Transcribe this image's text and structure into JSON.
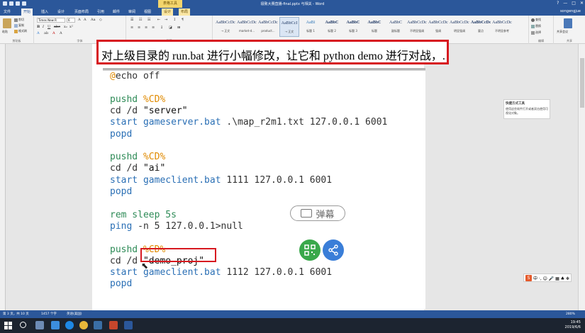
{
  "window": {
    "title": "极致大赛直播-final.pptx 与相关 - Word",
    "context_tab_title": "表格工具",
    "controls": [
      "?",
      "—",
      "□",
      "✕"
    ],
    "user": "songengjue"
  },
  "tabs": [
    "文件",
    "开始",
    "插入",
    "设计",
    "页面布局",
    "引用",
    "邮件",
    "审阅",
    "视图",
    "设计",
    "布局"
  ],
  "ribbon": {
    "clipboard": {
      "paste": "粘贴",
      "cut": "剪切",
      "copy": "复制",
      "painter": "格式刷",
      "label": "剪贴板"
    },
    "font": {
      "name": "Times New R",
      "size": "6",
      "label": "字体"
    },
    "paragraph": {
      "label": "段落"
    },
    "styles": {
      "label": "样式",
      "items": [
        {
          "sample": "AaBbCcDc",
          "name": "→ 正文"
        },
        {
          "sample": "AaBbCcDc",
          "name": "market-d..."
        },
        {
          "sample": "AaBbCcDc",
          "name": "product..."
        },
        {
          "sample": "AaBbCcI",
          "name": "→ 正文"
        },
        {
          "sample": "AaBl",
          "name": "标题 1"
        },
        {
          "sample": "AaBbC",
          "name": "标题 2"
        },
        {
          "sample": "AaBbC",
          "name": "标题 3"
        },
        {
          "sample": "AaBbC",
          "name": "标题"
        },
        {
          "sample": "AaBbC",
          "name": "副标题"
        },
        {
          "sample": "AaBbCcDc",
          "name": "不明显强调"
        },
        {
          "sample": "AaBbCcDc",
          "name": "强调"
        },
        {
          "sample": "AaBbCcDc",
          "name": "明显强调"
        },
        {
          "sample": "AaBbCcDc",
          "name": "要点"
        },
        {
          "sample": "AaBbCcDc",
          "name": "不明显参考"
        }
      ]
    },
    "editing": {
      "find": "查找",
      "replace": "替换",
      "select": "选择",
      "label": "编辑"
    },
    "share": {
      "label": "共享",
      "meeting": "共享会议"
    }
  },
  "instruction": "对上级目录的 run.bat 进行小幅修改，让它和 python demo 进行对战，.",
  "code": [
    [
      {
        "t": "@",
        "c": "var"
      },
      {
        "t": "echo off",
        "c": "op"
      }
    ],
    [],
    [
      {
        "t": "pushd ",
        "c": "kw"
      },
      {
        "t": "%CD%",
        "c": "var"
      }
    ],
    [
      {
        "t": "cd /d ",
        "c": "op"
      },
      {
        "t": "\"server\"",
        "c": "str"
      }
    ],
    [
      {
        "t": "start ",
        "c": "bl"
      },
      {
        "t": "gameserver.bat ",
        "c": "bl"
      },
      {
        "t": ".\\map_r2m1.txt 127.0.0.1 6001",
        "c": "op"
      }
    ],
    [
      {
        "t": "popd",
        "c": "bl"
      }
    ],
    [],
    [
      {
        "t": "pushd ",
        "c": "kw"
      },
      {
        "t": "%CD%",
        "c": "var"
      }
    ],
    [
      {
        "t": "cd /d ",
        "c": "op"
      },
      {
        "t": "\"ai\"",
        "c": "str"
      }
    ],
    [
      {
        "t": "start ",
        "c": "bl"
      },
      {
        "t": "gameclient.bat ",
        "c": "bl"
      },
      {
        "t": "1111 127.0.0.1 6001",
        "c": "op"
      }
    ],
    [
      {
        "t": "popd",
        "c": "bl"
      }
    ],
    [],
    [
      {
        "t": "rem sleep 5s",
        "c": "kw"
      }
    ],
    [
      {
        "t": "ping ",
        "c": "bl"
      },
      {
        "t": "-n 5 127.0.0.1>null",
        "c": "op"
      }
    ],
    [],
    [
      {
        "t": "pushd ",
        "c": "kw"
      },
      {
        "t": "%CD%",
        "c": "var"
      }
    ],
    [
      {
        "t": "cd /d ",
        "c": "op"
      },
      {
        "t": "\"demo_proj\"",
        "c": "str"
      }
    ],
    [
      {
        "t": "start ",
        "c": "bl"
      },
      {
        "t": "gameclient.bat ",
        "c": "bl"
      },
      {
        "t": "1112 127.0.0.1 6001",
        "c": "op"
      }
    ],
    [
      {
        "t": "popd",
        "c": "bl"
      }
    ]
  ],
  "overlay": {
    "danmaku_label": "弹幕"
  },
  "side_panel": {
    "heading": "快捷方式工具",
    "body": "使用这些软件打开或者双击使用可视化对象。"
  },
  "ime": {
    "logo": "S",
    "text": "中 ·, ☺ 🎤 ▦ ♣ ✻"
  },
  "status": {
    "page": "第 3 页，共 10 页",
    "words": "1457 个字",
    "lang": "英语(美国)",
    "zoom": "280%"
  },
  "taskbar": {
    "time": "19:45",
    "date": "2019/6/6"
  },
  "colors": {
    "accent": "#2b579a",
    "highlight_border": "#d71920",
    "kw": "#2e8b57",
    "var": "#e08a00"
  }
}
